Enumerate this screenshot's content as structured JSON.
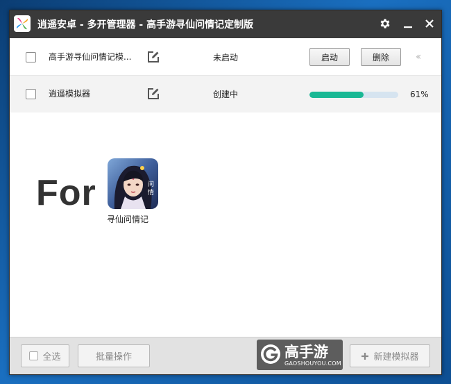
{
  "window": {
    "title": "逍遥安卓 - 多开管理器 - 高手游寻仙问情记定制版",
    "settings_icon": "gear-icon",
    "minimize_icon": "minimize-icon",
    "close_icon": "close-icon"
  },
  "instances": [
    {
      "name": "高手游寻仙问情记模...",
      "status": "未启动",
      "start_label": "启动",
      "delete_label": "删除"
    },
    {
      "name": "逍遥模拟器",
      "status": "创建中",
      "progress_percent": 61,
      "progress_text": "61%"
    }
  ],
  "promo": {
    "for_text": "For",
    "game_name": "寻仙问情记"
  },
  "footer": {
    "select_all_label": "全选",
    "batch_label": "批量操作",
    "brand_name": "高手游",
    "brand_domain": "GAOSHOUYOU.COM",
    "new_label": "新建模拟器"
  },
  "colors": {
    "titlebar": "#3a3a3a",
    "progress": "#19b894",
    "progress_track": "#d6e4f0"
  }
}
